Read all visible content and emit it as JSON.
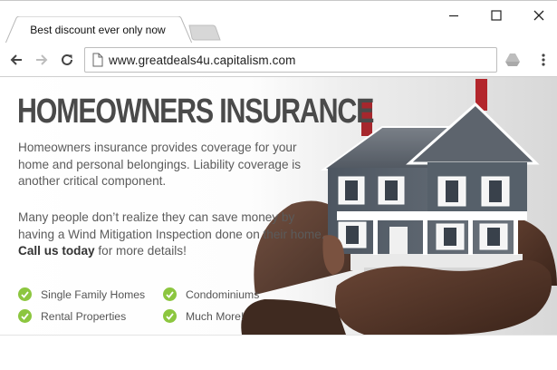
{
  "browser": {
    "tab_title": "Best discount ever only now",
    "url": "www.greatdeals4u.capitalism.com"
  },
  "ad": {
    "headline": "HOMEOWNERS INSURANCE",
    "para1": "Homeowners insurance provides coverage for your home and personal belongings. Liability coverage is another critical component.",
    "para2_text": "Many people don’t realize they can save money by having a Wind Mitigation Inspection done on their home.",
    "cta_bold": "Call us today",
    "cta_rest": " for more details!",
    "features": [
      "Single Family Homes",
      "Condominiums",
      "Rental Properties",
      "Much More!"
    ],
    "check_color": "#8cc63f"
  },
  "icons": {
    "tab_new": "new-tab-icon",
    "back": "back-arrow-icon",
    "forward": "forward-arrow-icon",
    "reload": "reload-icon",
    "page": "page-icon",
    "extension": "drive-icon",
    "menu": "menu-icon"
  }
}
